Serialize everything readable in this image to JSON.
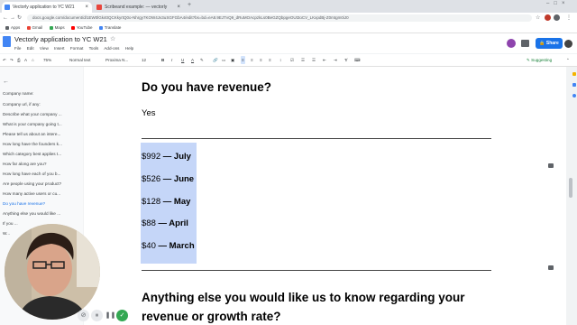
{
  "browser": {
    "tabs": [
      {
        "title": "Vectorly application to YC W21"
      },
      {
        "title": "Scribeand example: — vectorly"
      }
    ],
    "url": "docs.google.com/document/d/1EW0lGk40QCKkyrtQ0o-Nhrgy7KOW4Jv3uSGFGbA4/edit?bs=bd=eA8.9EJTvQ9_dRuMOAcpzkLs0BeGZQbpgeOUt3oCV_LKxpdBj-Z0mtgm0iJ0"
  },
  "bookmarks": [
    "Apps",
    "Gmail",
    "Maps",
    "YouTube",
    "Translate"
  ],
  "doc": {
    "title": "Vectorly application to YC W21",
    "menus": [
      "File",
      "Edit",
      "View",
      "Insert",
      "Format",
      "Tools",
      "Add-ons",
      "Help"
    ],
    "share_label": "Share"
  },
  "toolbar": {
    "zoom": "75%",
    "style": "Normal text",
    "font": "Proxima N...",
    "size": "12",
    "mode": "Suggesting"
  },
  "outline": [
    "Company name:",
    "Company url, if any:",
    "Describe what your company ...",
    "What is your company going t...",
    "Please tell us about an intere...",
    "How long have the founders k...",
    "Which category best applies t...",
    "How far along are you?",
    "How long have each of you b...",
    "Are people using your product?",
    "How many active users or cu...",
    "Do you have revenue?",
    "Anything else you would like ...",
    "If you ...",
    "W..."
  ],
  "content": {
    "heading1": "Do you have revenue?",
    "answer1": "Yes",
    "revenue": [
      {
        "amount": "$992",
        "sep": " — ",
        "month": "July"
      },
      {
        "amount": "$526",
        "sep": " — ",
        "month": "June"
      },
      {
        "amount": "$128",
        "sep": " — ",
        "month": "May"
      },
      {
        "amount": "$88",
        "sep": " — ",
        "month": "April"
      },
      {
        "amount": "$40",
        "sep": " — ",
        "month": "March"
      }
    ],
    "heading2_line1": "Anything else you would like us to know regarding your",
    "heading2_line2": "revenue or growth rate?"
  },
  "colors": {
    "accent": "#1a73e8",
    "selection": "#c5d6f8",
    "record": "#34a853"
  },
  "icons": [
    "back-icon",
    "forward-icon",
    "reload-icon",
    "star-icon",
    "docs-logo-icon",
    "comment-icon",
    "pause-icon",
    "check-icon",
    "delete-icon"
  ]
}
